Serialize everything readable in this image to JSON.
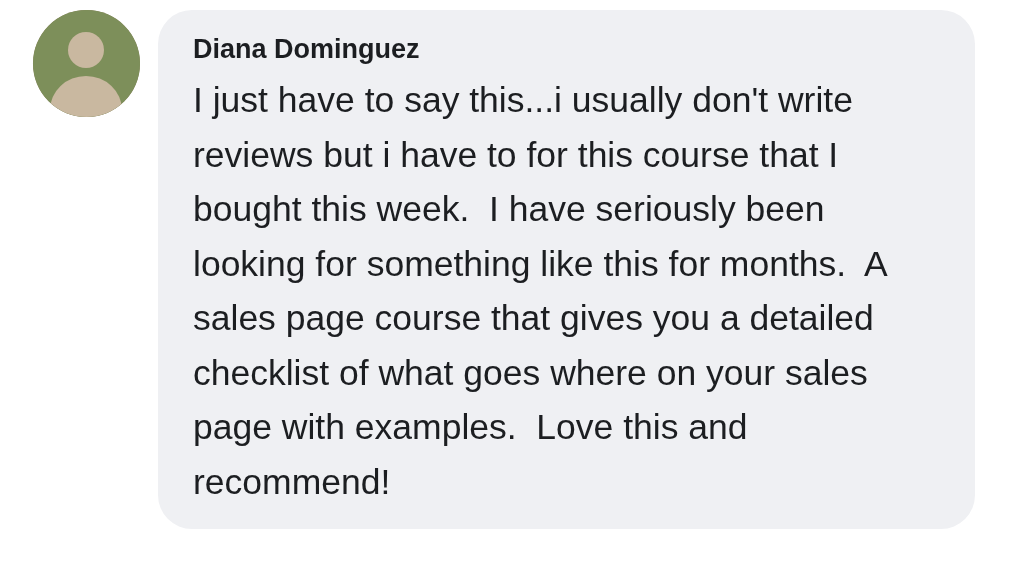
{
  "comment": {
    "author": "Diana Dominguez",
    "text": "I just have to say this...i usually don't write reviews but i have to for this course that I bought this week.  I have seriously been looking for something like this for months.  A sales page course that gives you a detailed checklist of what goes where on your sales page with examples.  Love this and recommend!"
  }
}
